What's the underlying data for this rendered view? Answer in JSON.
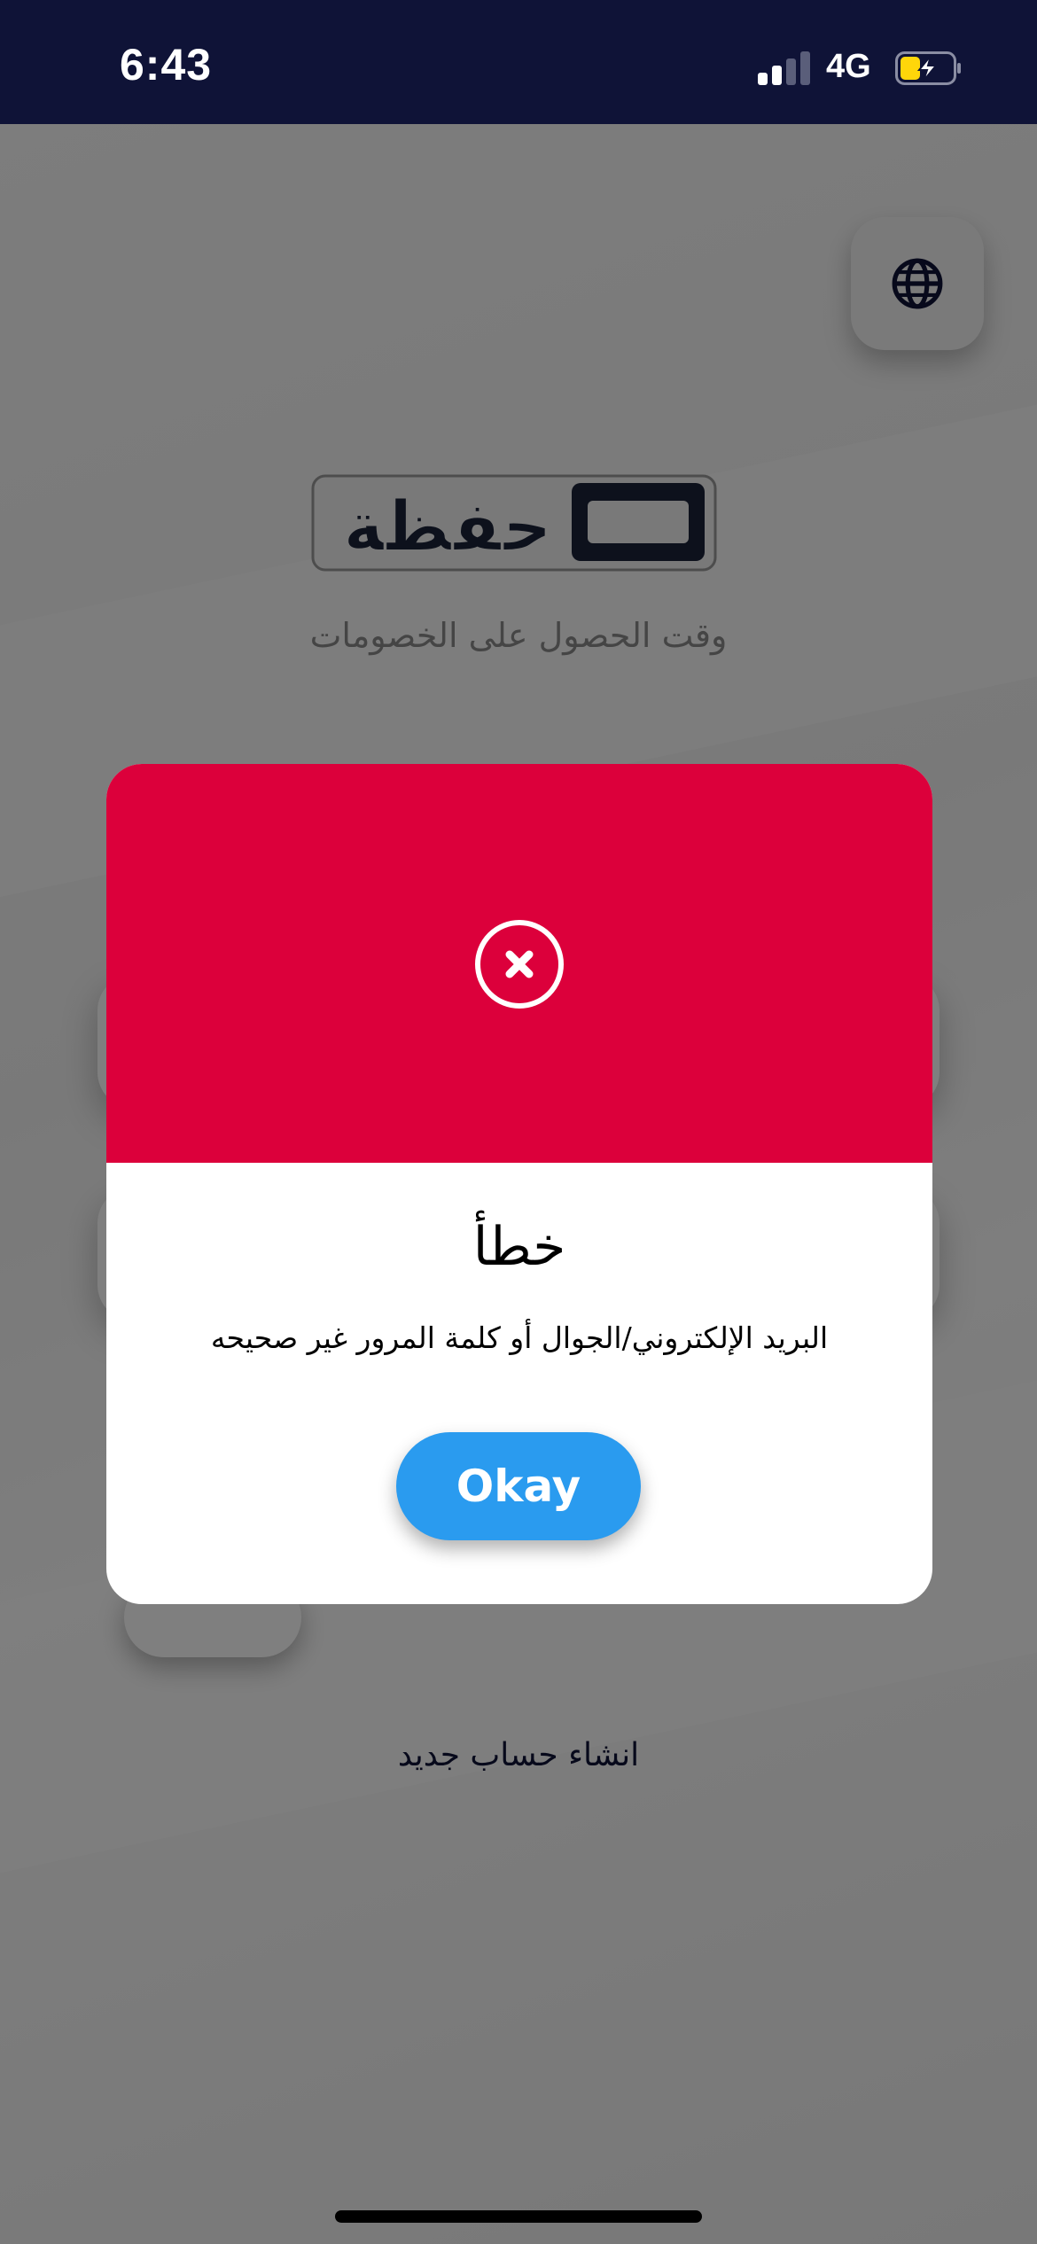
{
  "status_bar": {
    "time": "6:43",
    "network": "4G",
    "signal_bars_active": 2,
    "battery_charging": true
  },
  "header": {
    "language_icon": "globe-icon"
  },
  "logo": {
    "text": "حفظة"
  },
  "tagline": "وقت الحصول على الخصومات",
  "links": {
    "create_account": "انشاء حساب جديد"
  },
  "dialog": {
    "icon": "close-circle-icon",
    "title": "خطأ",
    "message": "البريد الإلكتروني/الجوال أو كلمة المرور غير صحيحه",
    "button_label": "Okay"
  },
  "colors": {
    "status_bar_bg": "#0f1337",
    "error_red": "#dc003b",
    "button_blue": "#2a9bef",
    "battery_yellow": "#ffd60a",
    "text_dark": "#0f1337"
  }
}
